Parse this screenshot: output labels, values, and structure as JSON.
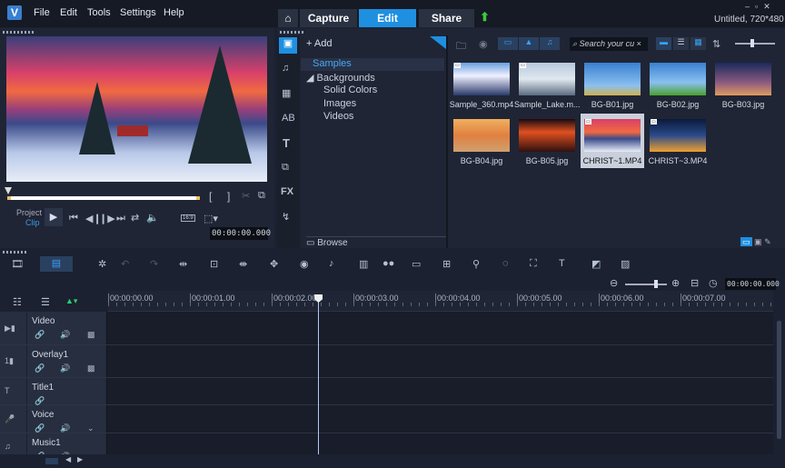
{
  "menu": {
    "items": [
      "File",
      "Edit",
      "Tools",
      "Settings",
      "Help"
    ],
    "logo": "V"
  },
  "tabs": {
    "home_icon": "home-icon",
    "items": [
      "Capture",
      "Edit",
      "Share"
    ],
    "active": "Edit",
    "upload_icon": "up-arrow-icon"
  },
  "window": {
    "title": "Untitled, 720*480"
  },
  "player": {
    "project_label": "Project",
    "clip_label": "Clip",
    "timecode": "00:00:00.000",
    "aspect": "16:9",
    "mark_in": "[",
    "mark_out": "]"
  },
  "library": {
    "add_label": "Add",
    "search_placeholder": "Search your cu",
    "browse_label": "Browse",
    "tree": [
      "Samples",
      "Backgrounds",
      "Solid Colors",
      "Images",
      "Videos"
    ],
    "selected_tree": "Samples",
    "fx_label": "FX",
    "media": [
      {
        "name": "Sample_360.mp4",
        "video": true
      },
      {
        "name": "Sample_Lake.m...",
        "video": true
      },
      {
        "name": "BG-B01.jpg"
      },
      {
        "name": "BG-B02.jpg"
      },
      {
        "name": "BG-B03.jpg"
      },
      {
        "name": "BG-B04.jpg"
      },
      {
        "name": "BG-B05.jpg"
      },
      {
        "name": "CHRIST~1.MP4",
        "video": true,
        "selected": true
      },
      {
        "name": "CHRIST~3.MP4",
        "video": true
      }
    ]
  },
  "timeline": {
    "zoom_time": "00:00:00.000",
    "ruler": [
      "00:00:00.00",
      "00:00:01.00",
      "00:00:02.00",
      "00:00:03.00",
      "00:00:04.00",
      "00:00:05.00",
      "00:00:06.00",
      "00:00:07.00"
    ],
    "tracks": [
      {
        "name": "Video"
      },
      {
        "name": "Overlay1"
      },
      {
        "name": "Title1"
      },
      {
        "name": "Voice"
      },
      {
        "name": "Music1"
      }
    ]
  },
  "colors": {
    "accent": "#1f8fe0",
    "active_tab": "#1f8fe0",
    "playhead": "#b8c8f0",
    "trim_bar": "#f0c060"
  }
}
